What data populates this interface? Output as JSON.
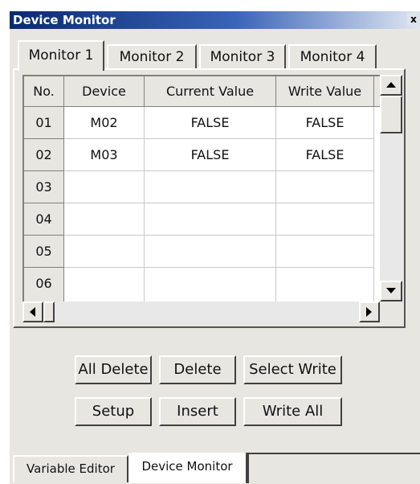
{
  "window": {
    "title": "Device Monitor",
    "close_label": "x"
  },
  "tabs": [
    "Monitor 1",
    "Monitor 2",
    "Monitor 3",
    "Monitor 4"
  ],
  "table": {
    "headers": [
      "No.",
      "Device",
      "Current Value",
      "Write Value"
    ],
    "rows": [
      {
        "no": "01",
        "device": "M02",
        "current": "FALSE",
        "write": "FALSE"
      },
      {
        "no": "02",
        "device": "M03",
        "current": "FALSE",
        "write": "FALSE"
      },
      {
        "no": "03",
        "device": "",
        "current": "",
        "write": ""
      },
      {
        "no": "04",
        "device": "",
        "current": "",
        "write": ""
      },
      {
        "no": "05",
        "device": "",
        "current": "",
        "write": ""
      },
      {
        "no": "06",
        "device": "",
        "current": "",
        "write": ""
      }
    ]
  },
  "buttons": {
    "all_delete": "All Delete",
    "delete": "Delete",
    "select_write": "Select Write",
    "setup": "Setup",
    "insert": "Insert",
    "write_all": "Write All"
  },
  "bottom_tabs": [
    "Variable Editor",
    "Device Monitor"
  ]
}
